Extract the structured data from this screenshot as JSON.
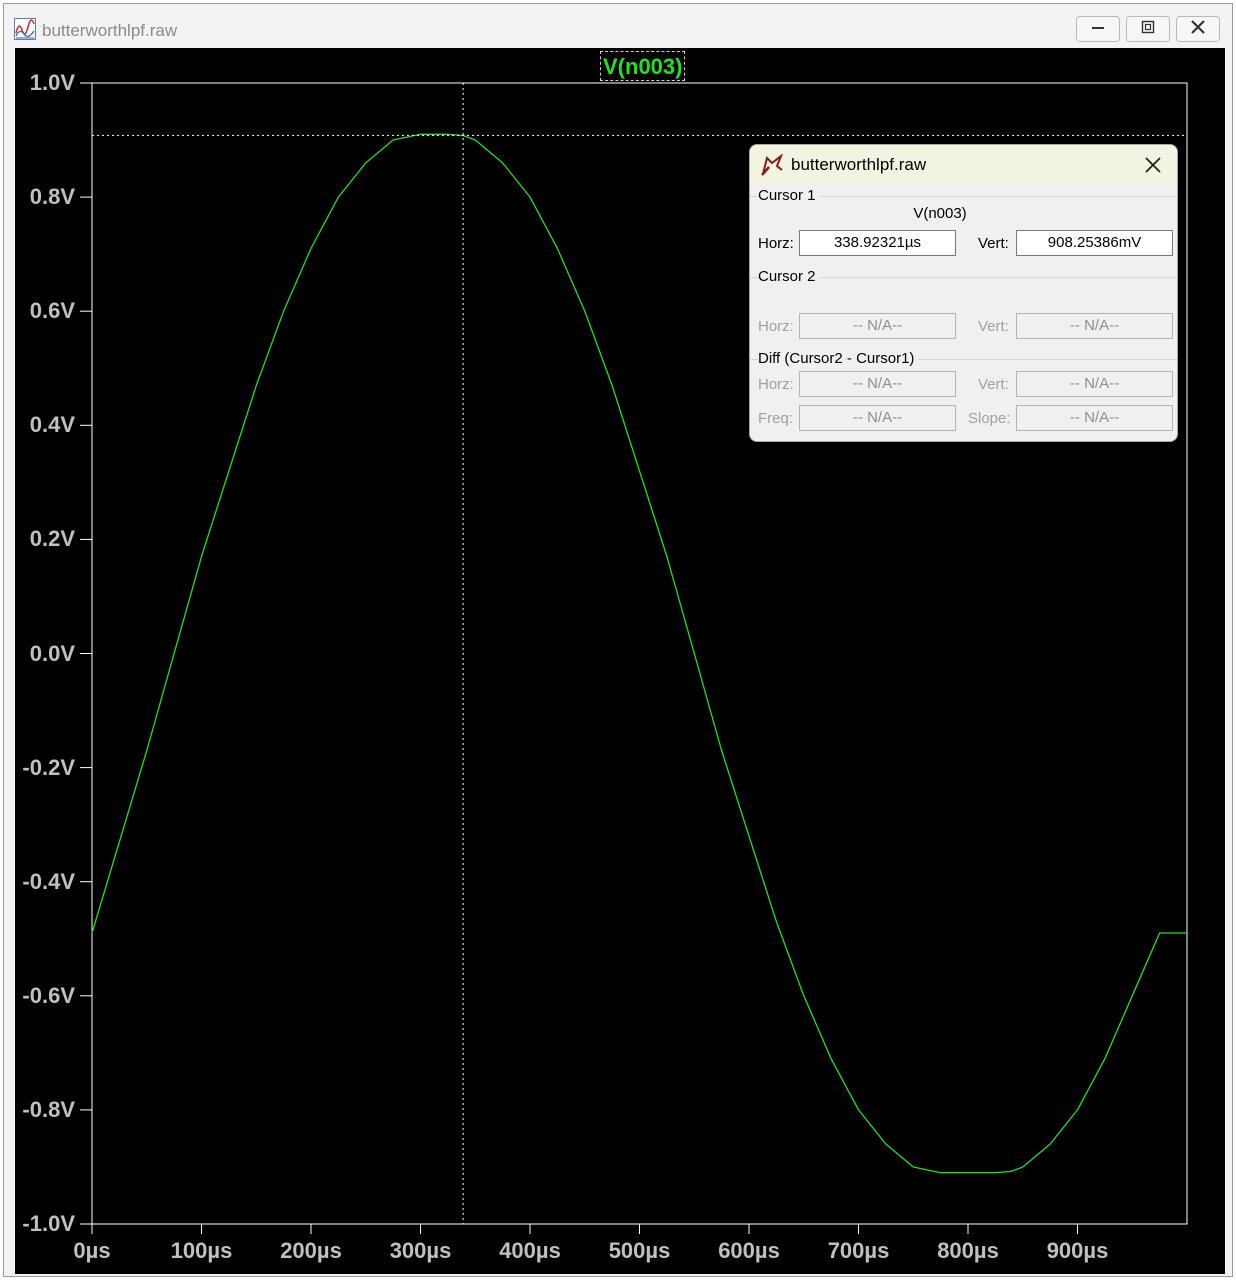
{
  "window": {
    "title": "butterworthlpf.raw",
    "icon": "waveform-icon",
    "controls": {
      "minimize": "minimize-icon",
      "restore": "restore-icon",
      "close": "close-icon"
    }
  },
  "trace": {
    "name": "V(n003)",
    "color": "#22e022"
  },
  "y_ticks": [
    "1.0V",
    "0.8V",
    "0.6V",
    "0.4V",
    "0.2V",
    "0.0V",
    "-0.2V",
    "-0.4V",
    "-0.6V",
    "-0.8V",
    "-1.0V"
  ],
  "x_ticks": [
    "0µs",
    "100µs",
    "200µs",
    "300µs",
    "400µs",
    "500µs",
    "600µs",
    "700µs",
    "800µs",
    "900µs"
  ],
  "chart_data": {
    "type": "line",
    "title": "V(n003)",
    "xlabel": "",
    "ylabel": "",
    "xlim": [
      0,
      1000
    ],
    "ylim": [
      -1.0,
      1.0
    ],
    "x_unit": "µs",
    "y_unit": "V",
    "grid": false,
    "series": [
      {
        "name": "V(n003)",
        "color": "#22e022",
        "x": [
          0,
          25,
          50,
          75,
          100,
          125,
          150,
          175,
          200,
          225,
          250,
          275,
          300,
          325,
          338.9,
          350,
          375,
          400,
          425,
          450,
          475,
          500,
          525,
          550,
          575,
          600,
          625,
          650,
          675,
          700,
          725,
          750,
          775,
          800,
          825,
          838.9,
          850,
          875,
          900,
          925,
          950,
          975,
          1000
        ],
        "y": [
          -0.49,
          -0.33,
          -0.17,
          -0.0,
          0.17,
          0.32,
          0.47,
          0.6,
          0.71,
          0.8,
          0.86,
          0.9,
          0.91,
          0.91,
          0.908,
          0.9,
          0.86,
          0.8,
          0.71,
          0.6,
          0.47,
          0.32,
          0.17,
          0.0,
          -0.17,
          -0.32,
          -0.47,
          -0.6,
          -0.71,
          -0.8,
          -0.86,
          -0.9,
          -0.91,
          -0.91,
          -0.91,
          -0.908,
          -0.9,
          -0.86,
          -0.8,
          -0.71,
          -0.6,
          -0.49,
          -0.49
        ]
      }
    ],
    "cursor": {
      "x": 338.92321,
      "y": 0.90825386
    }
  },
  "cursor_panel": {
    "title": "butterworthlpf.raw",
    "icon": "probe-icon",
    "close_icon": "close-icon",
    "cursor1": {
      "label": "Cursor 1",
      "trace": "V(n003)",
      "horz_label": "Horz:",
      "horz_value": "338.92321µs",
      "vert_label": "Vert:",
      "vert_value": "908.25386mV"
    },
    "cursor2": {
      "label": "Cursor 2",
      "horz_label": "Horz:",
      "horz_value": "-- N/A--",
      "vert_label": "Vert:",
      "vert_value": "-- N/A--"
    },
    "diff": {
      "label": "Diff (Cursor2 - Cursor1)",
      "horz_label": "Horz:",
      "horz_value": "-- N/A--",
      "vert_label": "Vert:",
      "vert_value": "-- N/A--",
      "freq_label": "Freq:",
      "freq_value": "-- N/A--",
      "slope_label": "Slope:",
      "slope_value": "-- N/A--"
    }
  }
}
